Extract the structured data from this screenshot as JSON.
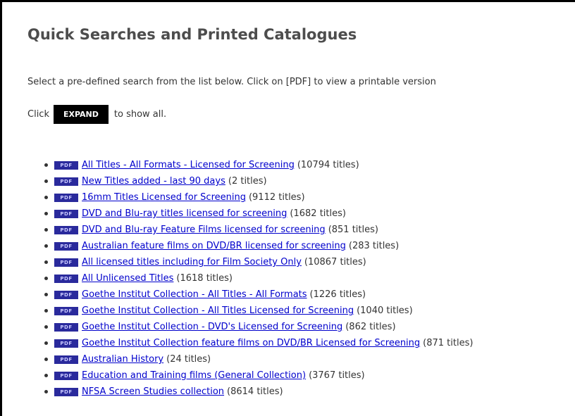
{
  "header": {
    "title": "Quick Searches and Printed Catalogues"
  },
  "intro": {
    "text": "Select a pre-defined search from the list below. Click on [PDF] to view a printable version"
  },
  "expand": {
    "prefix": "Click",
    "button_label": "EXPAND",
    "suffix": "to show all."
  },
  "icons": {
    "pdf_label": "PDF",
    "pdf_color": "#2a2a9c",
    "link_color": "#0000cc"
  },
  "searches": [
    {
      "label": "All Titles - All Formats - Licensed for Screening",
      "count": "(10794 titles)"
    },
    {
      "label": "New Titles added - last 90 days",
      "count": "(2 titles)"
    },
    {
      "label": "16mm Titles Licensed for Screening",
      "count": "(9112 titles)"
    },
    {
      "label": "DVD and Blu-ray titles licensed for screening",
      "count": "(1682 titles)"
    },
    {
      "label": "DVD and Blu-ray Feature Films licensed for screening",
      "count": "(851 titles)"
    },
    {
      "label": "Australian feature films on DVD/BR licensed for screening",
      "count": "(283 titles)"
    },
    {
      "label": "All licensed titles including for Film Society Only",
      "count": "(10867 titles)"
    },
    {
      "label": "All Unlicensed Titles",
      "count": "(1618 titles)"
    },
    {
      "label": "Goethe Institut Collection - All Titles - All Formats",
      "count": "(1226 titles)"
    },
    {
      "label": "Goethe Institut Collection - All Titles Licensed for Screening",
      "count": "(1040 titles)"
    },
    {
      "label": "Goethe Institut Collection - DVD's Licensed for Screening",
      "count": "(862 titles)"
    },
    {
      "label": "Goethe Institut Collection feature films on DVD/BR Licensed for Screening",
      "count": "(871 titles)"
    },
    {
      "label": "Australian History",
      "count": "(24 titles)"
    },
    {
      "label": "Education and Training films (General Collection)",
      "count": "(3767 titles)"
    },
    {
      "label": "NFSA Screen Studies collection",
      "count": "(8614 titles)"
    }
  ]
}
